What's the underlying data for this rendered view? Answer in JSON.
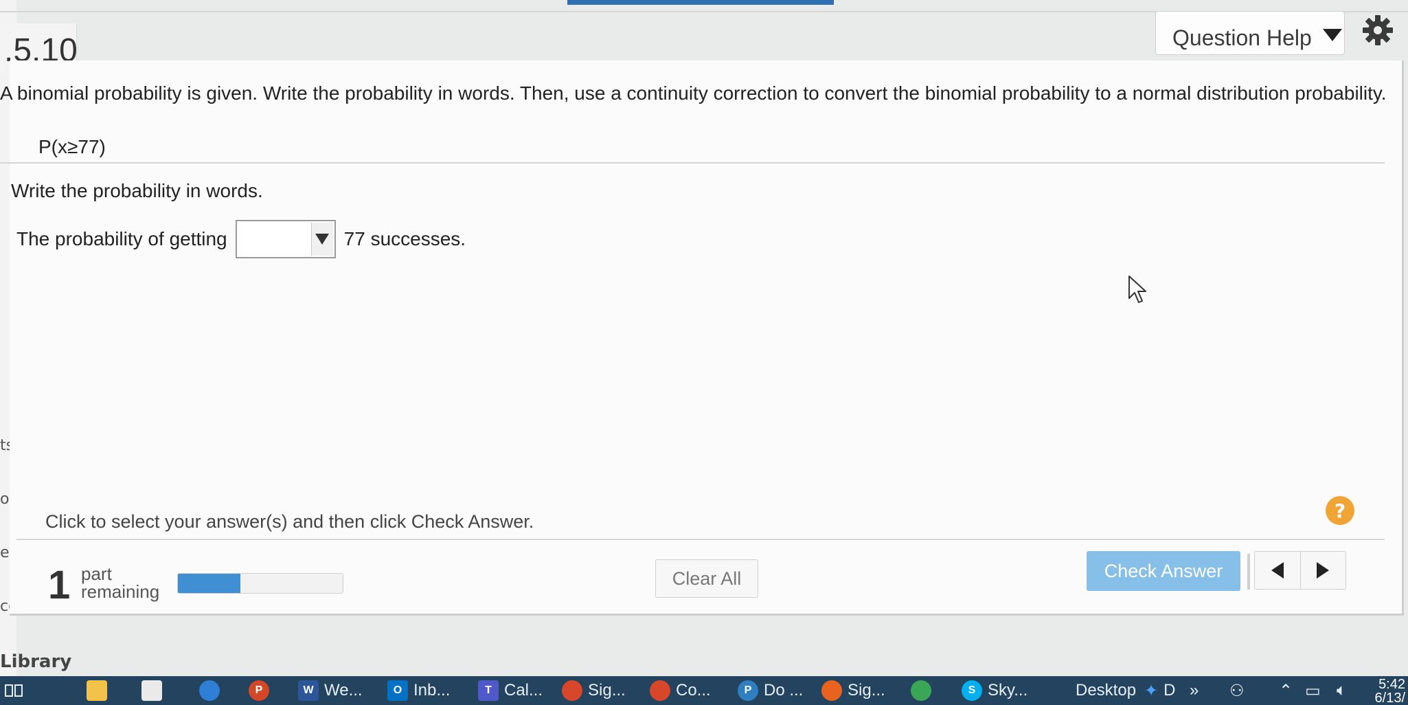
{
  "header": {
    "question_number": ".5.10",
    "question_help_label": "Question Help"
  },
  "left_margin": {
    "labels": [
      "ts",
      "ourc",
      "ess",
      "cess"
    ]
  },
  "question": {
    "prompt": "A binomial probability is given. Write the probability in words. Then, use a continuity correction to convert the binomial probability to a normal distribution probability.",
    "expression": "P(x≥77)",
    "write_label": "Write the probability in words.",
    "sentence_prefix": "The probability of getting",
    "dropdown_value": "",
    "sentence_suffix": "77 successes."
  },
  "footer": {
    "instructions": "Click to select your answer(s) and then click Check Answer.",
    "help_symbol": "?",
    "parts_count": "1",
    "parts_label_1": "part",
    "parts_label_2": "remaining",
    "progress": 0.38,
    "clear_all_label": "Clear All",
    "check_answer_label": "Check Answer"
  },
  "library_label": "Library",
  "taskbar": {
    "items": [
      {
        "label": "We...",
        "icon": "word-icon",
        "color": "#2b579a",
        "letter": "W"
      },
      {
        "label": "Inb...",
        "icon": "outlook-icon",
        "color": "#0072c6",
        "letter": "O"
      },
      {
        "label": "Cal...",
        "icon": "teams-icon",
        "color": "#5059c9",
        "letter": "T"
      },
      {
        "label": "Sig...",
        "icon": "chrome-icon",
        "color": "#d8472a",
        "letter": ""
      },
      {
        "label": "Co...",
        "icon": "chrome-icon",
        "color": "#d8472a",
        "letter": ""
      },
      {
        "label": "Do ...",
        "icon": "pandora-icon",
        "color": "#2d7fc1",
        "letter": "P"
      },
      {
        "label": "Sig...",
        "icon": "firefox-icon",
        "color": "#e8641e",
        "letter": ""
      },
      {
        "label": "Sky...",
        "icon": "skype-icon",
        "color": "#00aff0",
        "letter": "S"
      }
    ],
    "desktop_label": "Desktop",
    "tray_letter": "D",
    "tray_more": "»",
    "time": "5:42",
    "date": "6/13/"
  },
  "colors": {
    "accent": "#3f8fd2",
    "check_button": "#86c0e8",
    "help_circle": "#f0a433",
    "taskbar": "#23435e"
  }
}
